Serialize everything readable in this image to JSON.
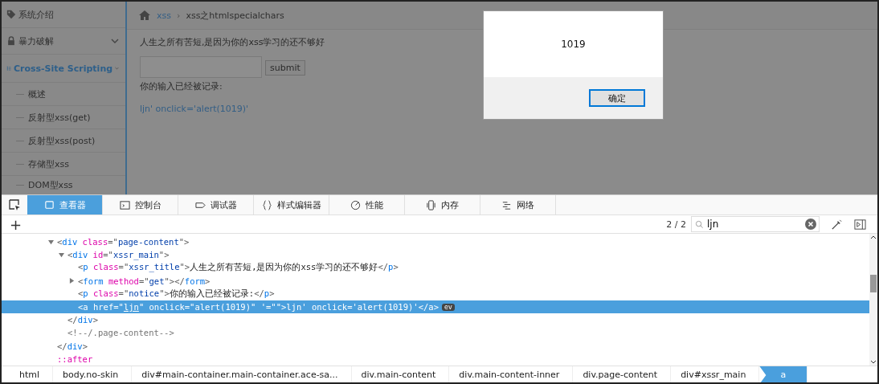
{
  "sidebar": {
    "items": [
      {
        "label": "系统介绍",
        "kind": "section",
        "selected": false
      },
      {
        "label": "暴力破解",
        "kind": "group",
        "selected": false
      },
      {
        "label": "Cross-Site Scripting",
        "kind": "group",
        "selected": true
      },
      {
        "label": "概述",
        "kind": "sub",
        "selected": false
      },
      {
        "label": "反射型xss(get)",
        "kind": "sub",
        "selected": false
      },
      {
        "label": "反射型xss(post)",
        "kind": "sub",
        "selected": false
      },
      {
        "label": "存储型xss",
        "kind": "sub",
        "selected": false
      },
      {
        "label": "DOM型xss",
        "kind": "sub",
        "selected": false
      }
    ]
  },
  "breadcrumb": {
    "link": "xss",
    "separator": "›",
    "current": "xss之htmlspecialchars"
  },
  "page": {
    "title": "人生之所有苦短,是因为你的xss学习的还不够好",
    "button": "submit",
    "notice": "你的输入已经被记录:",
    "output_link": "ljn' onclick='alert(1019)'"
  },
  "dialog": {
    "message": "1019",
    "button": "确定"
  },
  "devtools": {
    "tabs": [
      {
        "label": "查看器",
        "selected": true
      },
      {
        "label": "控制台",
        "selected": false
      },
      {
        "label": "调试器",
        "selected": false
      },
      {
        "label": "样式编辑器",
        "selected": false
      },
      {
        "label": "性能",
        "selected": false
      },
      {
        "label": "内存",
        "selected": false
      },
      {
        "label": "网络",
        "selected": false
      }
    ],
    "add": "+",
    "match_count": "2 / 2",
    "search": {
      "value": "ljn"
    },
    "markup": [
      {
        "selected": false,
        "expanded": true,
        "open": [
          {
            "kind": "p",
            "text": "<"
          },
          {
            "kind": "tag",
            "text": "div"
          },
          {
            "kind": "attr",
            "text": " class"
          },
          {
            "kind": "p",
            "text": "=\""
          },
          {
            "kind": "val",
            "text": "page-content"
          },
          {
            "kind": "p",
            "text": "\">"
          }
        ],
        "close": [
          {
            "kind": "p",
            "text": "</"
          },
          {
            "kind": "tag",
            "text": "div"
          },
          {
            "kind": "p",
            "text": ">"
          }
        ],
        "children": [
          {
            "selected": false,
            "expanded": true,
            "open": [
              {
                "kind": "p",
                "text": "<"
              },
              {
                "kind": "tag",
                "text": "div"
              },
              {
                "kind": "attr",
                "text": " id"
              },
              {
                "kind": "p",
                "text": "=\""
              },
              {
                "kind": "val",
                "text": "xssr_main"
              },
              {
                "kind": "p",
                "text": "\">"
              }
            ],
            "close": [
              {
                "kind": "p",
                "text": "</"
              },
              {
                "kind": "tag",
                "text": "div"
              },
              {
                "kind": "p",
                "text": ">"
              }
            ],
            "children": [
              {
                "selected": false,
                "open": [
                  {
                    "kind": "p",
                    "text": "<"
                  },
                  {
                    "kind": "tag",
                    "text": "p"
                  },
                  {
                    "kind": "attr",
                    "text": " class"
                  },
                  {
                    "kind": "p",
                    "text": "=\""
                  },
                  {
                    "kind": "val",
                    "text": "xssr_title"
                  },
                  {
                    "kind": "p",
                    "text": "\">"
                  },
                  {
                    "kind": "txt",
                    "text": "人生之所有苦短,是因为你的xss学习的还不够好"
                  },
                  {
                    "kind": "p",
                    "text": "</"
                  },
                  {
                    "kind": "tag",
                    "text": "p"
                  },
                  {
                    "kind": "p",
                    "text": ">"
                  }
                ]
              },
              {
                "selected": false,
                "expanded": false,
                "open": [
                  {
                    "kind": "p",
                    "text": "<"
                  },
                  {
                    "kind": "tag",
                    "text": "form"
                  },
                  {
                    "kind": "attr",
                    "text": " method"
                  },
                  {
                    "kind": "p",
                    "text": "=\""
                  },
                  {
                    "kind": "val",
                    "text": "get"
                  },
                  {
                    "kind": "p",
                    "text": "\"></"
                  },
                  {
                    "kind": "tag",
                    "text": "form"
                  },
                  {
                    "kind": "p",
                    "text": ">"
                  }
                ]
              },
              {
                "selected": false,
                "open": [
                  {
                    "kind": "p",
                    "text": "<"
                  },
                  {
                    "kind": "tag",
                    "text": "p"
                  },
                  {
                    "kind": "attr",
                    "text": " class"
                  },
                  {
                    "kind": "p",
                    "text": "=\""
                  },
                  {
                    "kind": "val",
                    "text": "notice"
                  },
                  {
                    "kind": "p",
                    "text": "\">"
                  },
                  {
                    "kind": "txt",
                    "text": "你的输入已经被记录:"
                  },
                  {
                    "kind": "p",
                    "text": "</"
                  },
                  {
                    "kind": "tag",
                    "text": "p"
                  },
                  {
                    "kind": "p",
                    "text": ">"
                  }
                ]
              },
              {
                "selected": true,
                "badge": "ev",
                "open": [
                  {
                    "kind": "p",
                    "text": "<"
                  },
                  {
                    "kind": "tag",
                    "text": "a"
                  },
                  {
                    "kind": "attr",
                    "text": " href"
                  },
                  {
                    "kind": "p",
                    "text": "=\""
                  },
                  {
                    "kind": "link",
                    "text": "ljn"
                  },
                  {
                    "kind": "p",
                    "text": "\""
                  },
                  {
                    "kind": "attr",
                    "text": " onclick"
                  },
                  {
                    "kind": "p",
                    "text": "=\""
                  },
                  {
                    "kind": "val",
                    "text": "alert(1019)"
                  },
                  {
                    "kind": "p",
                    "text": "\""
                  },
                  {
                    "kind": "attr",
                    "text": " '"
                  },
                  {
                    "kind": "p",
                    "text": "=\""
                  },
                  {
                    "kind": "p",
                    "text": "\">"
                  },
                  {
                    "kind": "txt",
                    "text": "ljn' onclick='alert(1019)'"
                  },
                  {
                    "kind": "p",
                    "text": "</"
                  },
                  {
                    "kind": "tag",
                    "text": "a"
                  },
                  {
                    "kind": "p",
                    "text": ">"
                  }
                ]
              }
            ]
          },
          {
            "selected": false,
            "open": [
              {
                "kind": "comment",
                "text": "<!--/.page-content-->"
              }
            ]
          }
        ]
      },
      {
        "selected": false,
        "open": [
          {
            "kind": "pseudo",
            "text": "::after"
          }
        ]
      }
    ],
    "breadcrumbs": [
      {
        "label": "html",
        "selected": false
      },
      {
        "label": "body.no-skin",
        "selected": false
      },
      {
        "label": "div#main-container.main-container.ace-sa...",
        "selected": false
      },
      {
        "label": "div.main-content",
        "selected": false
      },
      {
        "label": "div.main-content-inner",
        "selected": false
      },
      {
        "label": "div.page-content",
        "selected": false
      },
      {
        "label": "div#xssr_main",
        "selected": false
      },
      {
        "label": "a",
        "selected": true
      }
    ]
  }
}
